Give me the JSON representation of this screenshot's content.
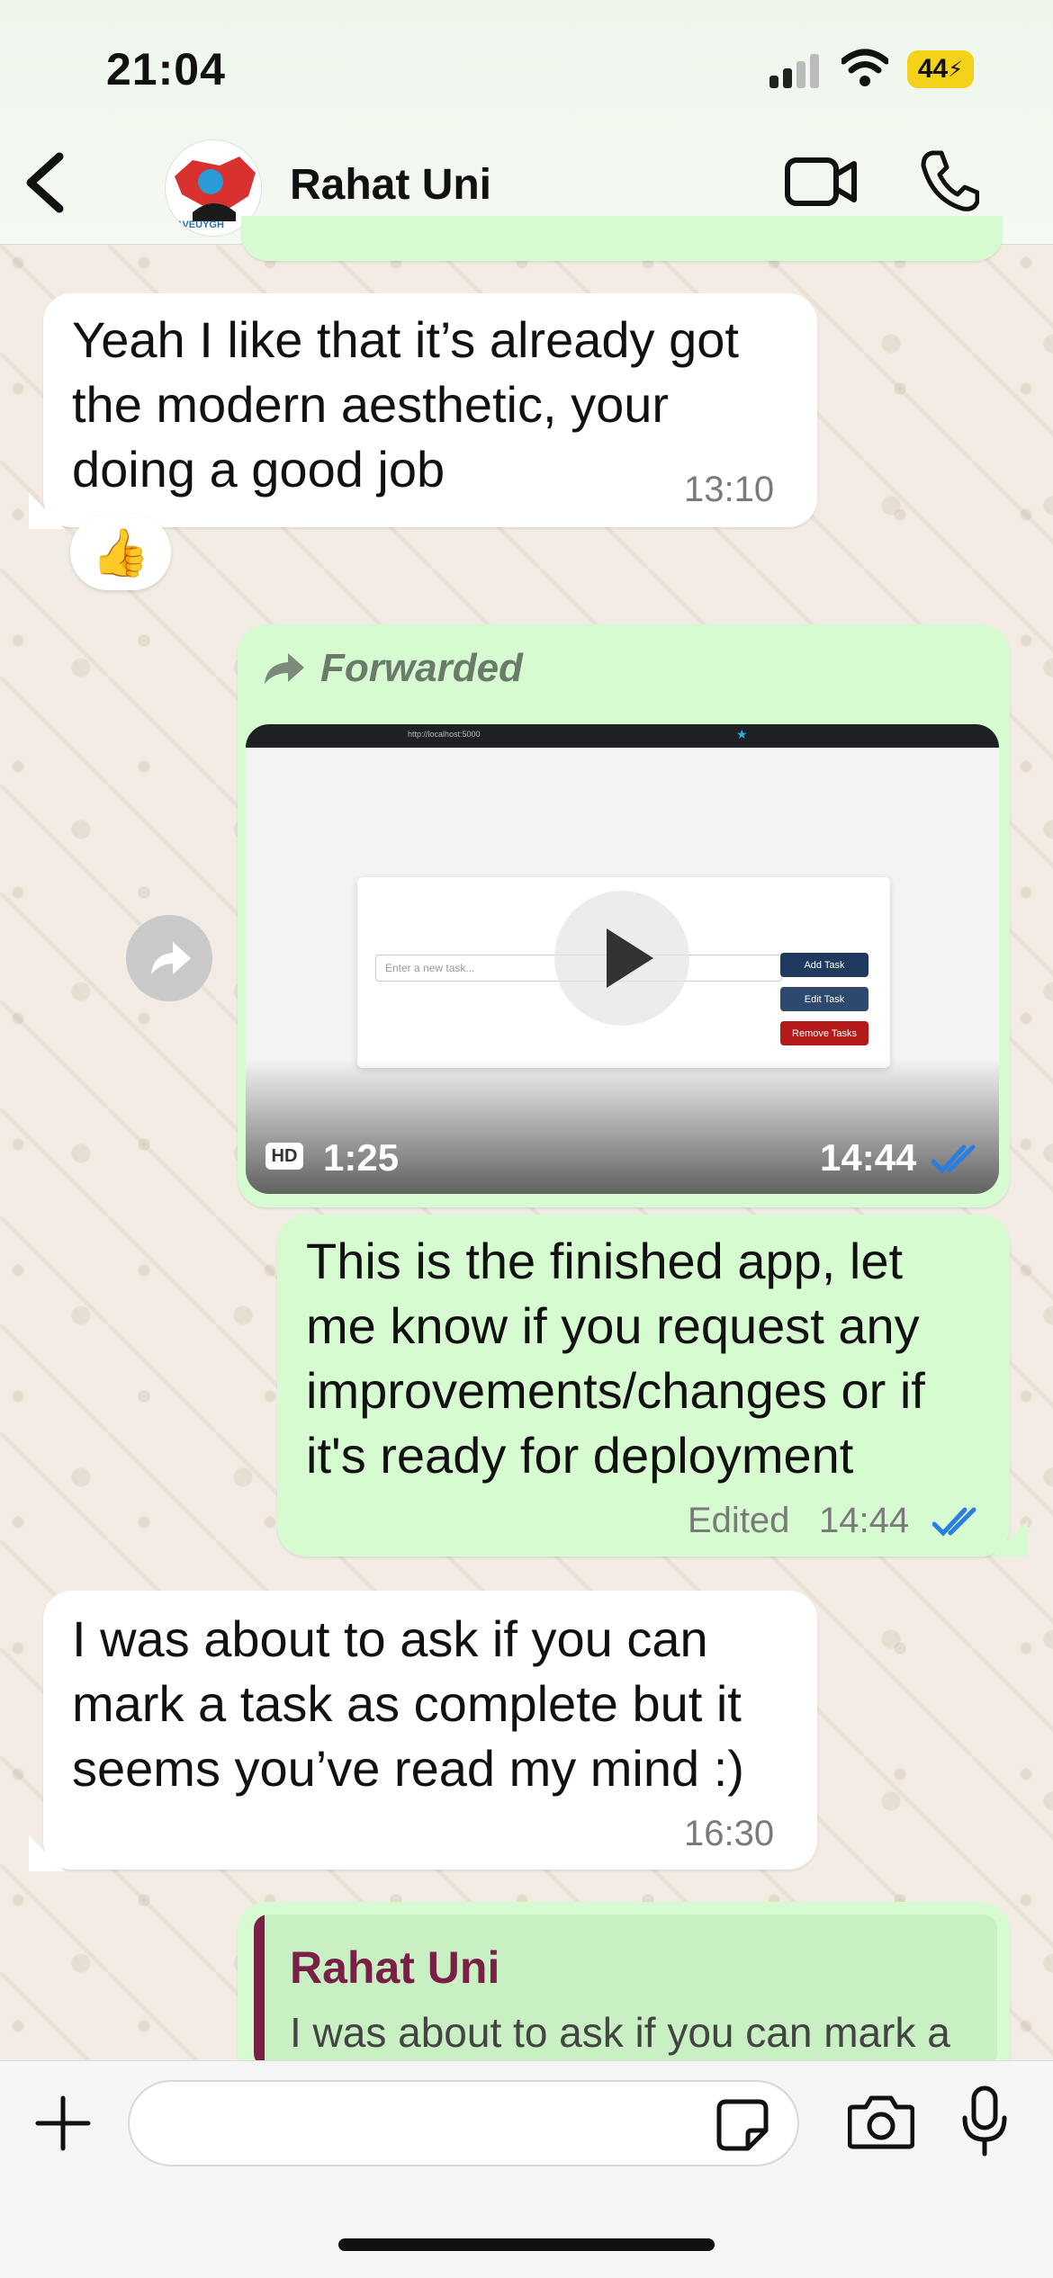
{
  "status_bar": {
    "time": "21:04",
    "battery": "44"
  },
  "header": {
    "contact_name": "Rahat Uni",
    "avatar_text": "SAVEUYGH"
  },
  "messages": [
    {
      "id": "m1",
      "direction": "incoming",
      "text_lines": [
        "Yeah I like that it’s already got",
        "the modern aesthetic, your",
        "doing a good job"
      ],
      "time": "13:10",
      "reaction": "👍"
    },
    {
      "id": "m2",
      "direction": "outgoing",
      "forwarded_label": "Forwarded",
      "media": "video",
      "hd_badge": "HD",
      "duration": "1:25",
      "time": "14:44",
      "preview": {
        "url_text": "http://localhost:5000",
        "input_placeholder": "Enter a new task...",
        "buttons": [
          "Add Task",
          "Edit Task",
          "Remove Tasks"
        ]
      }
    },
    {
      "id": "m3",
      "direction": "outgoing",
      "text_lines": [
        "This is the finished app, let",
        "me know if you request any",
        "improvements/changes or if",
        "it's ready for deployment"
      ],
      "edited_label": "Edited",
      "time": "14:44"
    },
    {
      "id": "m4",
      "direction": "incoming",
      "text_lines": [
        "I was about to ask if you can",
        "mark a task as complete but it",
        "seems you’ve read my mind :)"
      ],
      "time": "16:30"
    },
    {
      "id": "m5",
      "direction": "outgoing",
      "reply": {
        "name": "Rahat Uni",
        "text": "I was about to ask if you can mark a"
      }
    }
  ],
  "composer": {
    "value": ""
  },
  "colors": {
    "outgoing_bubble": "#d7fbd0",
    "incoming_bubble": "#ffffff",
    "read_ticks": "#2a7de1",
    "reply_accent": "#7a1f46"
  }
}
